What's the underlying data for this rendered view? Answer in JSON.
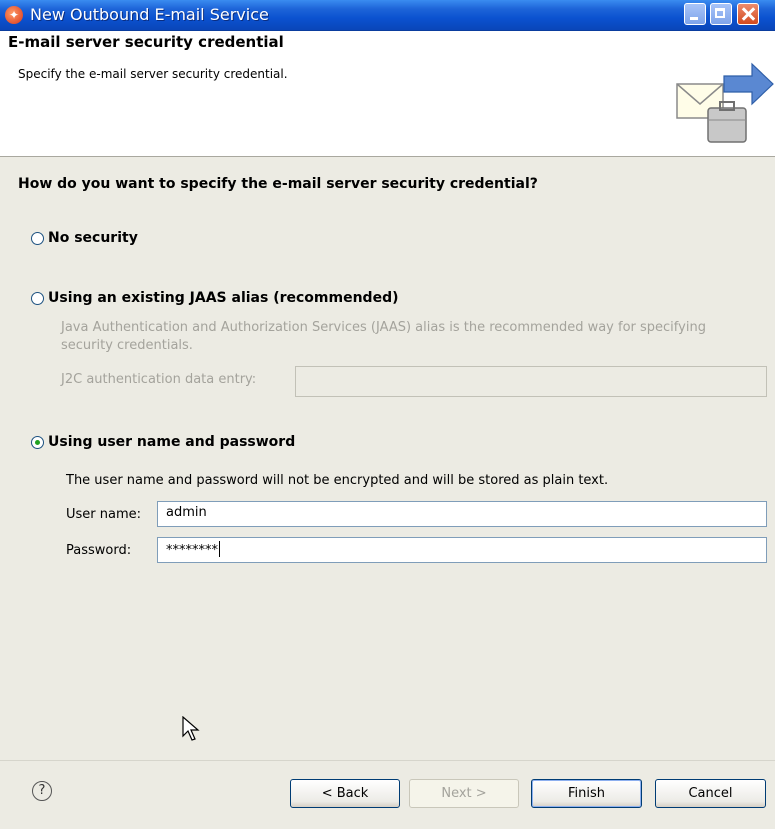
{
  "window": {
    "title": "New Outbound E-mail Service"
  },
  "banner": {
    "title": "E-mail server security credential",
    "description": "Specify the e-mail server security credential."
  },
  "content": {
    "question": "How do you want to specify the e-mail server security credential?",
    "options": [
      {
        "label": "No security",
        "selected": false
      },
      {
        "label": "Using an existing JAAS alias (recommended)",
        "selected": false
      },
      {
        "label": "Using user name and password",
        "selected": true
      }
    ],
    "jaas": {
      "description": "Java Authentication and Authorization Services (JAAS) alias is the recommended way for specifying security credentials.",
      "j2c_label": "J2C authentication data entry:",
      "j2c_value": ""
    },
    "credentials": {
      "note": "The user name and password will not be encrypted and will be stored as plain text.",
      "username_label": "User name:",
      "username_value": "admin",
      "password_label": "Password:",
      "password_value": "********"
    }
  },
  "footer": {
    "help_icon": "question-mark-icon",
    "back": "< Back",
    "next": "Next >",
    "finish": "Finish",
    "cancel": "Cancel"
  },
  "colors": {
    "titlebar": "#0b52d0",
    "dialog_bg": "#ecebe3",
    "radio_selected": "#21a121",
    "disabled_text": "#a4a39c"
  }
}
